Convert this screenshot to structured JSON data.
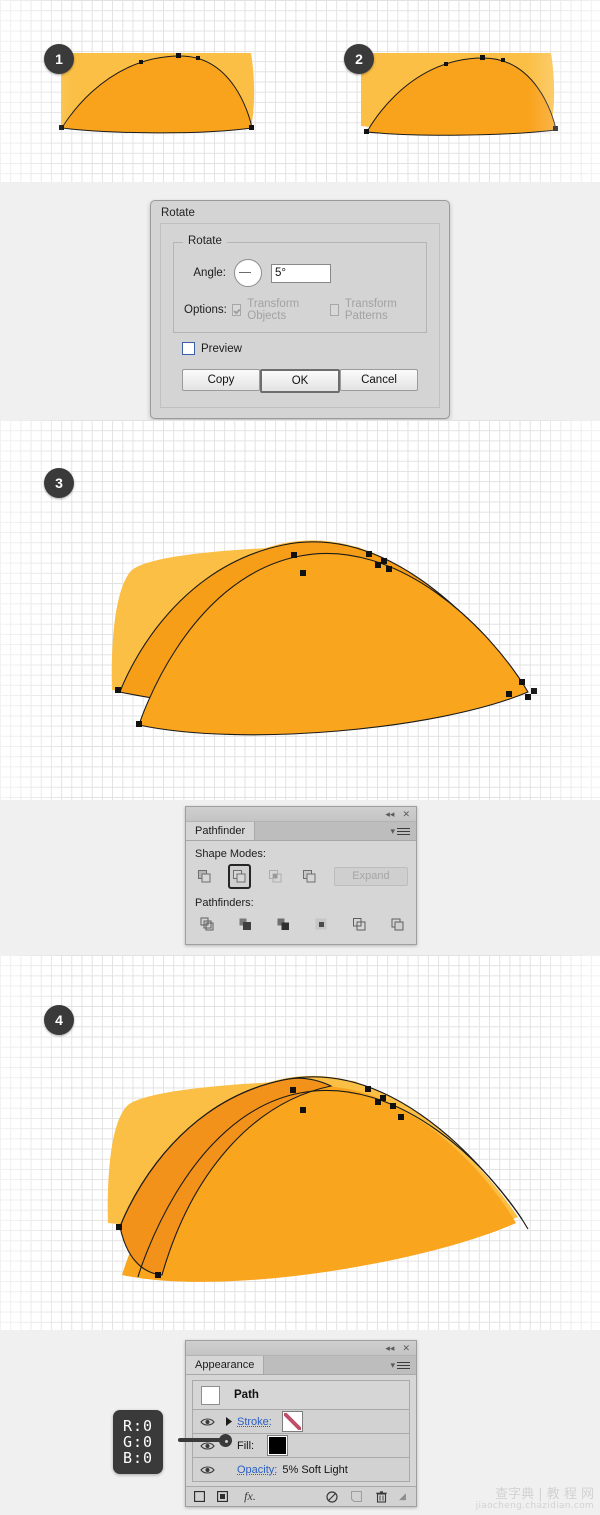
{
  "steps": [
    {
      "number": "1"
    },
    {
      "number": "2"
    },
    {
      "number": "3"
    },
    {
      "number": "4"
    }
  ],
  "rotate_dialog": {
    "title": "Rotate",
    "group_legend": "Rotate",
    "angle_label": "Angle:",
    "angle_value": "5°",
    "options_label": "Options:",
    "transform_objects": "Transform Objects",
    "transform_patterns": "Transform Patterns",
    "preview_label": "Preview",
    "copy_button": "Copy",
    "ok_button": "OK",
    "cancel_button": "Cancel"
  },
  "pathfinder_panel": {
    "tab": "Pathfinder",
    "shape_modes_label": "Shape Modes:",
    "pathfinders_label": "Pathfinders:",
    "expand_button": "Expand",
    "shape_modes": [
      {
        "name": "unite",
        "selected": false
      },
      {
        "name": "minus-front",
        "selected": true
      },
      {
        "name": "intersect",
        "selected": false
      },
      {
        "name": "exclude",
        "selected": false
      }
    ],
    "pathfinders": [
      {
        "name": "divide"
      },
      {
        "name": "trim"
      },
      {
        "name": "merge"
      },
      {
        "name": "crop"
      },
      {
        "name": "outline"
      },
      {
        "name": "minus-back"
      }
    ]
  },
  "appearance_panel": {
    "tab": "Appearance",
    "path_label": "Path",
    "stroke_label": "Stroke:",
    "fill_label": "Fill:",
    "opacity_label": "Opacity:",
    "opacity_value": "5% Soft Light",
    "footer_icons": [
      "add-new-stroke-icon",
      "add-new-fill-icon",
      "add-new-effect-icon",
      "clear-appearance-icon",
      "duplicate-item-icon",
      "delete-item-icon"
    ]
  },
  "rgb_callout": {
    "r": "R:0",
    "g": "G:0",
    "b": "B:0"
  },
  "watermark": {
    "main": "查字典 | 教 程 网",
    "sub": "jiaocheng.chazidian.com"
  },
  "colors": {
    "light_orange": "#FBBF45",
    "mid_orange": "#F9A82A",
    "dark_orange": "#F99D15",
    "badge": "#3a3a3a",
    "panel_bg": "#d6d6d6",
    "dialog_bg": "#d4d4d4",
    "link_blue": "#2b5fc4",
    "grid_line": "#e2e2e2"
  }
}
